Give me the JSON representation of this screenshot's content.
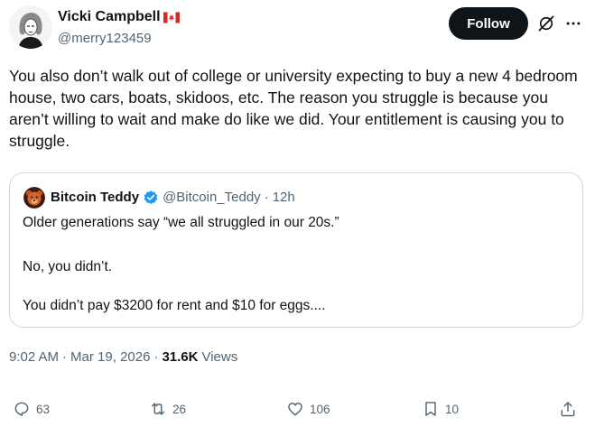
{
  "author": {
    "display_name": "Vicki Campbell",
    "flag_icon": "canada-flag-icon",
    "handle": "@merry123459"
  },
  "header": {
    "follow_label": "Follow",
    "grok_icon": "grok-icon",
    "more_icon": "more-options-icon"
  },
  "tweet": {
    "text": "You also don’t walk out of college or university expecting to buy a new 4 bedroom house, two cars, boats, skidoos, etc. The reason you struggle is because you aren’t willing to wait and make do like we did. Your entitlement is causing you to struggle."
  },
  "quoted": {
    "display_name": "Bitcoin Teddy",
    "verified_icon": "verified-badge-icon",
    "handle": "@Bitcoin_Teddy",
    "separator": "·",
    "time": "12h",
    "lines": [
      "Older generations say “we all struggled in our 20s.”",
      "No, you didn’t.",
      "You didn’t pay $3200 for rent and $10 for eggs...."
    ]
  },
  "meta": {
    "time": "9:02 AM",
    "sep1": "·",
    "date": "Mar 19, 2026",
    "sep2": "·",
    "views_count": "31.6K",
    "views_label": "Views"
  },
  "actions": {
    "replies": "63",
    "reposts": "26",
    "likes": "106",
    "bookmarks": "10"
  },
  "colors": {
    "text": "#0f1419",
    "secondary": "#536471",
    "border": "#cfd9de",
    "verified": "#1d9bf0",
    "follow_bg": "#0f1419"
  }
}
